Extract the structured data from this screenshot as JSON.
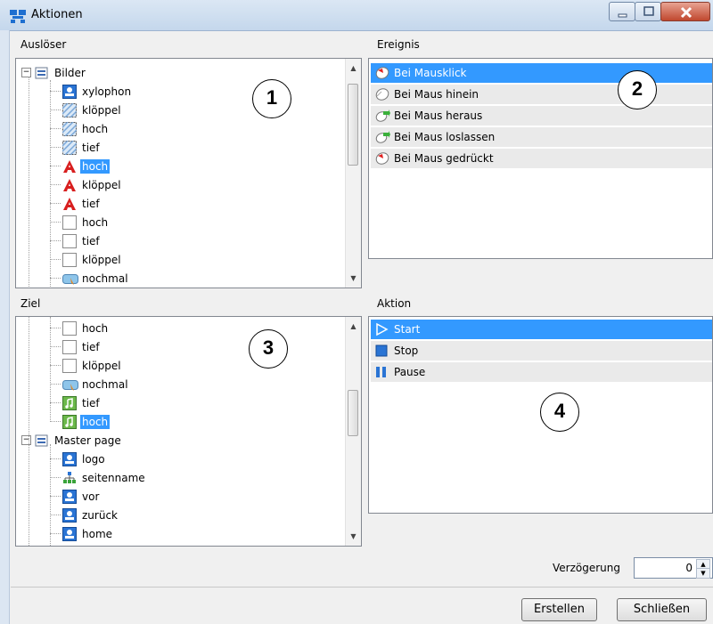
{
  "window": {
    "title": "Aktionen"
  },
  "sections": {
    "trigger": "Auslöser",
    "event": "Ereignis",
    "target": "Ziel",
    "action": "Aktion"
  },
  "trigger_tree": [
    {
      "label": "Bilder",
      "icon": "folder-icon",
      "root": true
    },
    {
      "label": "xylophon",
      "icon": "image-icon"
    },
    {
      "label": "klöppel",
      "icon": "hatched-shape-icon"
    },
    {
      "label": "hoch",
      "icon": "hatched-shape-icon"
    },
    {
      "label": "tief",
      "icon": "hatched-shape-icon"
    },
    {
      "label": "hoch",
      "icon": "text-icon",
      "selected": true
    },
    {
      "label": "klöppel",
      "icon": "text-icon"
    },
    {
      "label": "tief",
      "icon": "text-icon"
    },
    {
      "label": "hoch",
      "icon": "blank-icon"
    },
    {
      "label": "tief",
      "icon": "blank-icon"
    },
    {
      "label": "klöppel",
      "icon": "blank-icon"
    },
    {
      "label": "nochmal",
      "icon": "button-icon"
    }
  ],
  "target_tree": [
    {
      "label": "hoch",
      "icon": "blank-icon"
    },
    {
      "label": "tief",
      "icon": "blank-icon"
    },
    {
      "label": "klöppel",
      "icon": "blank-icon"
    },
    {
      "label": "nochmal",
      "icon": "button-icon"
    },
    {
      "label": "tief",
      "icon": "sound-icon"
    },
    {
      "label": "hoch",
      "icon": "sound-icon",
      "selected": true
    },
    {
      "label": "Master page",
      "icon": "folder-icon",
      "root": true
    },
    {
      "label": "logo",
      "icon": "image-icon"
    },
    {
      "label": "seitenname",
      "icon": "network-icon"
    },
    {
      "label": "vor",
      "icon": "image-icon"
    },
    {
      "label": "zurück",
      "icon": "image-icon"
    },
    {
      "label": "home",
      "icon": "image-icon"
    }
  ],
  "events": [
    {
      "label": "Bei Mausklick",
      "icon": "mouse-click-icon",
      "selected": true
    },
    {
      "label": "Bei Maus hinein",
      "icon": "mouse-enter-icon"
    },
    {
      "label": "Bei Maus heraus",
      "icon": "mouse-leave-icon"
    },
    {
      "label": "Bei Maus loslassen",
      "icon": "mouse-release-icon"
    },
    {
      "label": "Bei Maus gedrückt",
      "icon": "mouse-down-icon"
    }
  ],
  "actions": [
    {
      "label": "Start",
      "icon": "play-icon",
      "selected": true
    },
    {
      "label": "Stop",
      "icon": "stop-icon"
    },
    {
      "label": "Pause",
      "icon": "pause-icon"
    }
  ],
  "callouts": [
    "1",
    "2",
    "3",
    "4"
  ],
  "delay": {
    "label": "Verzögerung",
    "value": "0"
  },
  "buttons": {
    "create": "Erstellen",
    "close": "Schließen"
  }
}
